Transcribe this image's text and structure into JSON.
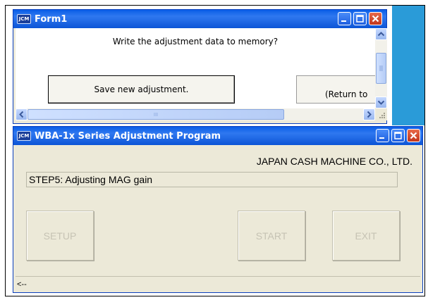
{
  "form1": {
    "title": "Form1",
    "prompt": "Write the adjustment data to memory?",
    "save_button": "Save new adjustment.",
    "return_button": "(Return to",
    "scroll_thumb_grip": "III"
  },
  "main": {
    "title": "WBA-1x Series Adjustment Program",
    "company": "JAPAN CASH MACHINE CO., LTD.",
    "step": "STEP5: Adjusting MAG gain",
    "buttons": {
      "setup": "SETUP",
      "start": "START",
      "exit": "EXIT"
    },
    "status": "<--"
  },
  "app_icon_text": "JCM",
  "colors": {
    "titlebar": "#0a5ee6",
    "desktop": "#2a9bd8",
    "window_bg": "#ece9d8",
    "disabled_text": "#c6c3b4"
  }
}
